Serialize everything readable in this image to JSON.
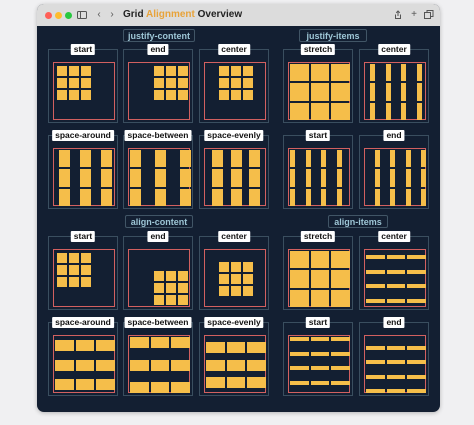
{
  "window": {
    "title_prefix": "Grid ",
    "title_accent": "Alignment",
    "title_suffix": " Overview",
    "colors": {
      "accent": "#e8a33a",
      "item": "#f5be4a",
      "container_border": "#d26060",
      "background": "#131f32"
    }
  },
  "icons": [
    "sidebar-icon",
    "back-icon",
    "forward-icon",
    "share-icon",
    "new-tab-icon",
    "tabs-icon"
  ],
  "sections": {
    "justify_content": "justify-content",
    "justify_items": "justify-items",
    "align_content": "align-content",
    "align_items": "align-items"
  },
  "panels": [
    {
      "label": "start",
      "section": "justify-content"
    },
    {
      "label": "end",
      "section": "justify-content"
    },
    {
      "label": "center",
      "section": "justify-content"
    },
    {
      "label": "stretch",
      "section": "justify-items"
    },
    {
      "label": "center",
      "section": "justify-items"
    },
    {
      "label": "space-around",
      "section": "justify-content"
    },
    {
      "label": "space-between",
      "section": "justify-content"
    },
    {
      "label": "space-evenly",
      "section": "justify-content"
    },
    {
      "label": "start",
      "section": "justify-items"
    },
    {
      "label": "end",
      "section": "justify-items"
    },
    {
      "label": "start",
      "section": "align-content"
    },
    {
      "label": "end",
      "section": "align-content"
    },
    {
      "label": "center",
      "section": "align-content"
    },
    {
      "label": "stretch",
      "section": "align-items"
    },
    {
      "label": "center",
      "section": "align-items"
    },
    {
      "label": "space-around",
      "section": "align-content"
    },
    {
      "label": "space-between",
      "section": "align-content"
    },
    {
      "label": "space-evenly",
      "section": "align-content"
    },
    {
      "label": "start",
      "section": "align-items"
    },
    {
      "label": "end",
      "section": "align-items"
    }
  ]
}
